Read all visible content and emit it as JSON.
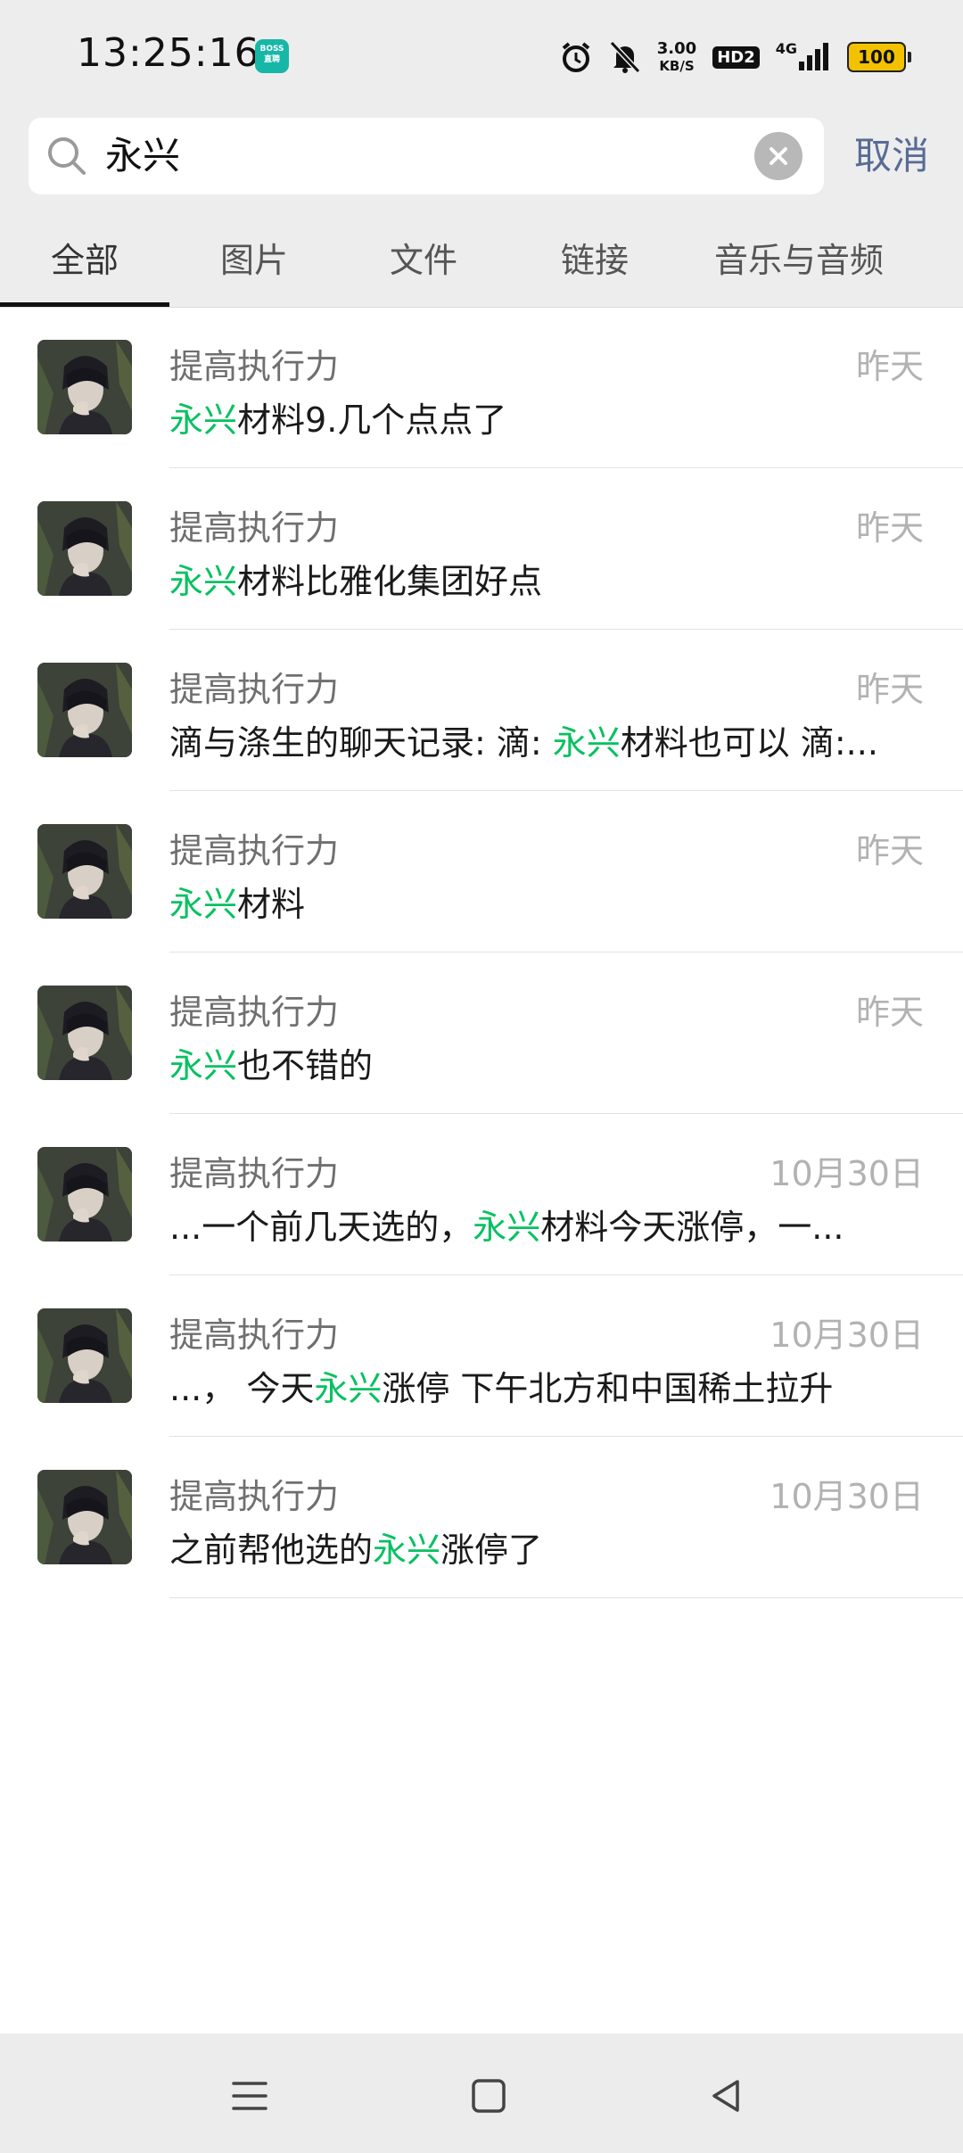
{
  "status_bar": {
    "time": "13:25:16",
    "app_badge": "BOSS\n直聘",
    "net_speed_value": "3.00",
    "net_speed_unit": "KB/S",
    "hd_label": "HD2",
    "network_label": "4G",
    "battery": "100",
    "icons": [
      "alarm-icon",
      "mute-icon",
      "signal-icon"
    ]
  },
  "search": {
    "query": "永兴",
    "placeholder": "",
    "cancel_label": "取消"
  },
  "tabs": [
    {
      "label": "全部",
      "active": true
    },
    {
      "label": "图片"
    },
    {
      "label": "文件"
    },
    {
      "label": "链接"
    },
    {
      "label": "音乐与音频"
    }
  ],
  "results": [
    {
      "title": "提高执行力",
      "date": "昨天",
      "pre": "",
      "hl": "永兴",
      "post": "材料9.几个点点了"
    },
    {
      "title": "提高执行力",
      "date": "昨天",
      "pre": "",
      "hl": "永兴",
      "post": "材料比雅化集团好点"
    },
    {
      "title": "提高执行力",
      "date": "昨天",
      "pre": "滴与涤生的聊天记录: 滴: ",
      "hl": "永兴",
      "post": "材料也可以 滴:..."
    },
    {
      "title": "提高执行力",
      "date": "昨天",
      "pre": "",
      "hl": "永兴",
      "post": "材料"
    },
    {
      "title": "提高执行力",
      "date": "昨天",
      "pre": "",
      "hl": "永兴",
      "post": "也不错的"
    },
    {
      "title": "提高执行力",
      "date": "10月30日",
      "pre": "...一个前几天选的，",
      "hl": "永兴",
      "post": "材料今天涨停，一..."
    },
    {
      "title": "提高执行力",
      "date": "10月30日",
      "pre": "...， 今天",
      "hl": "永兴",
      "post": "涨停   下午北方和中国稀土拉升"
    },
    {
      "title": "提高执行力",
      "date": "10月30日",
      "pre": "之前帮他选的",
      "hl": "永兴",
      "post": "涨停了"
    }
  ],
  "colors": {
    "highlight": "#07c160",
    "cancel": "#576b95",
    "header_bg": "#ededed"
  },
  "navbar": {
    "icons": [
      "menu-icon",
      "home-icon",
      "back-icon"
    ]
  }
}
